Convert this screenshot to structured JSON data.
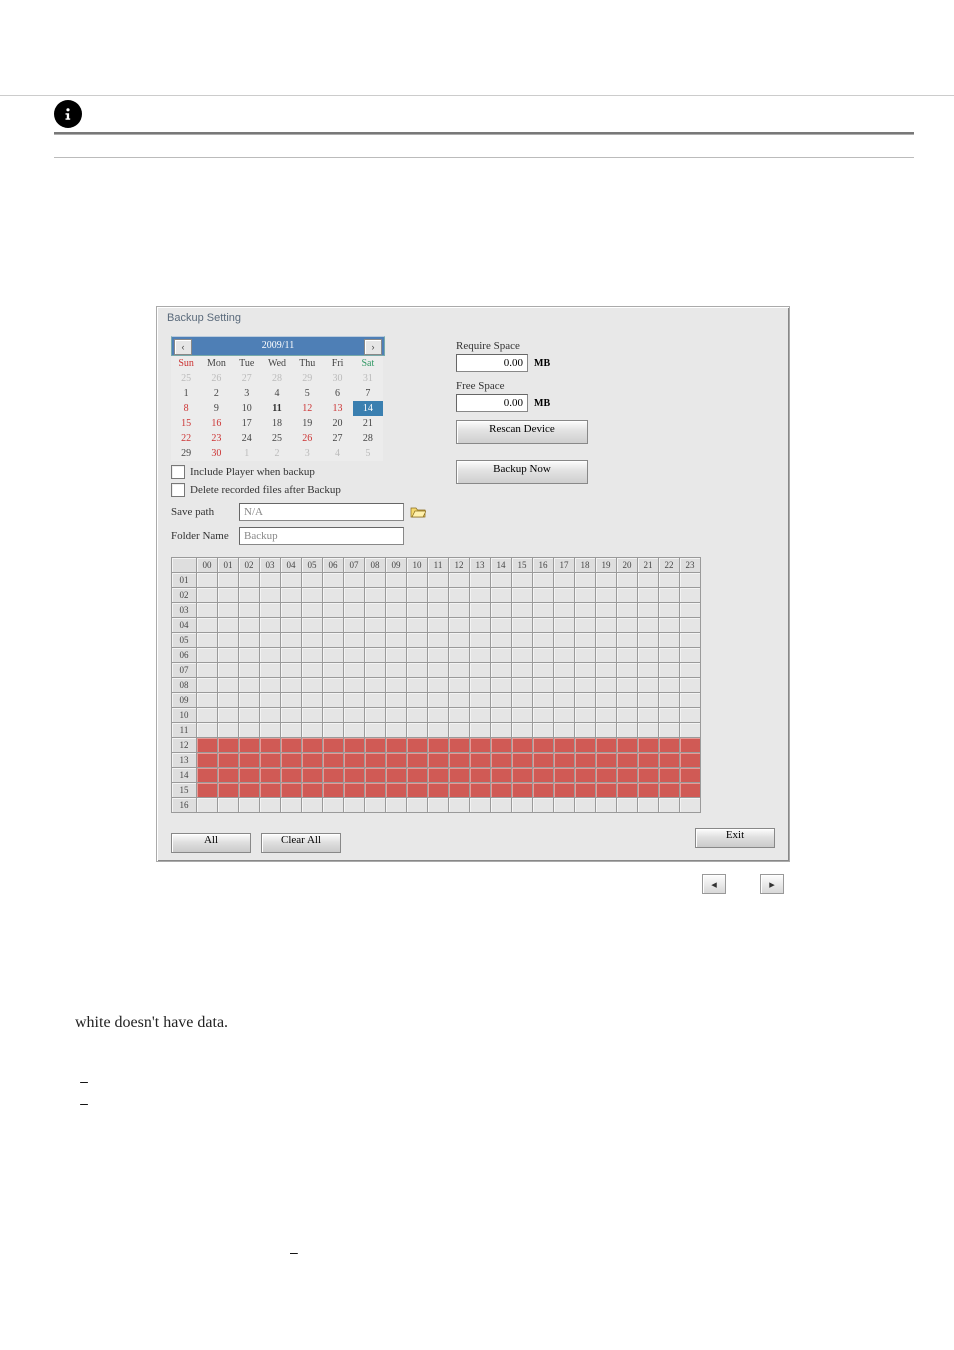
{
  "panel": {
    "title": "Backup Setting",
    "calendar": {
      "month_label": "2009/11",
      "weekdays": [
        "Sun",
        "Mon",
        "Tue",
        "Wed",
        "Thu",
        "Fri",
        "Sat"
      ],
      "weeks": [
        [
          {
            "n": "25",
            "cls": "d-out"
          },
          {
            "n": "26",
            "cls": "d-out"
          },
          {
            "n": "27",
            "cls": "d-out"
          },
          {
            "n": "28",
            "cls": "d-out"
          },
          {
            "n": "29",
            "cls": "d-out"
          },
          {
            "n": "30",
            "cls": "d-out"
          },
          {
            "n": "31",
            "cls": "d-out"
          }
        ],
        [
          {
            "n": "1",
            "cls": ""
          },
          {
            "n": "2",
            "cls": ""
          },
          {
            "n": "3",
            "cls": ""
          },
          {
            "n": "4",
            "cls": ""
          },
          {
            "n": "5",
            "cls": ""
          },
          {
            "n": "6",
            "cls": ""
          },
          {
            "n": "7",
            "cls": ""
          }
        ],
        [
          {
            "n": "8",
            "cls": "d-red"
          },
          {
            "n": "9",
            "cls": ""
          },
          {
            "n": "10",
            "cls": ""
          },
          {
            "n": "11",
            "cls": "d-bold"
          },
          {
            "n": "12",
            "cls": "d-red"
          },
          {
            "n": "13",
            "cls": "d-red"
          },
          {
            "n": "14",
            "cls": "d-sel"
          }
        ],
        [
          {
            "n": "15",
            "cls": "d-red"
          },
          {
            "n": "16",
            "cls": "d-red"
          },
          {
            "n": "17",
            "cls": ""
          },
          {
            "n": "18",
            "cls": ""
          },
          {
            "n": "19",
            "cls": ""
          },
          {
            "n": "20",
            "cls": ""
          },
          {
            "n": "21",
            "cls": ""
          }
        ],
        [
          {
            "n": "22",
            "cls": "d-red"
          },
          {
            "n": "23",
            "cls": "d-red"
          },
          {
            "n": "24",
            "cls": ""
          },
          {
            "n": "25",
            "cls": ""
          },
          {
            "n": "26",
            "cls": "d-red"
          },
          {
            "n": "27",
            "cls": ""
          },
          {
            "n": "28",
            "cls": ""
          }
        ],
        [
          {
            "n": "29",
            "cls": ""
          },
          {
            "n": "30",
            "cls": "d-red"
          },
          {
            "n": "1",
            "cls": "d-out"
          },
          {
            "n": "2",
            "cls": "d-out"
          },
          {
            "n": "3",
            "cls": "d-out"
          },
          {
            "n": "4",
            "cls": "d-out"
          },
          {
            "n": "5",
            "cls": "d-out"
          }
        ]
      ]
    },
    "checkboxes": {
      "include_player": "Include Player when backup",
      "delete_after": "Delete recorded files after Backup"
    },
    "fields": {
      "save_path_label": "Save path",
      "save_path_value": "N/A",
      "folder_name_label": "Folder Name",
      "folder_name_value": "Backup"
    },
    "right": {
      "require_space_label": "Require Space",
      "require_space_value": "0.00",
      "free_space_label": "Free Space",
      "free_space_value": "0.00",
      "mb_unit": "MB",
      "rescan_button": "Rescan Device",
      "backup_button": "Backup Now"
    },
    "schedule": {
      "hours": [
        "00",
        "01",
        "02",
        "03",
        "04",
        "05",
        "06",
        "07",
        "08",
        "09",
        "10",
        "11",
        "12",
        "13",
        "14",
        "15",
        "16",
        "17",
        "18",
        "19",
        "20",
        "21",
        "22",
        "23"
      ],
      "rows": [
        "01",
        "02",
        "03",
        "04",
        "05",
        "06",
        "07",
        "08",
        "09",
        "10",
        "11",
        "12",
        "13",
        "14",
        "15",
        "16"
      ],
      "red_rows": [
        "12",
        "13",
        "14",
        "15"
      ]
    },
    "footer": {
      "all": "All",
      "clear_all": "Clear All",
      "exit": "Exit"
    }
  },
  "body_text": "white doesn't have data.",
  "bullets": {
    "b1": "",
    "b2": ""
  },
  "nav_arrows": {
    "prev_glyph": "◂",
    "next_glyph": "▸"
  }
}
